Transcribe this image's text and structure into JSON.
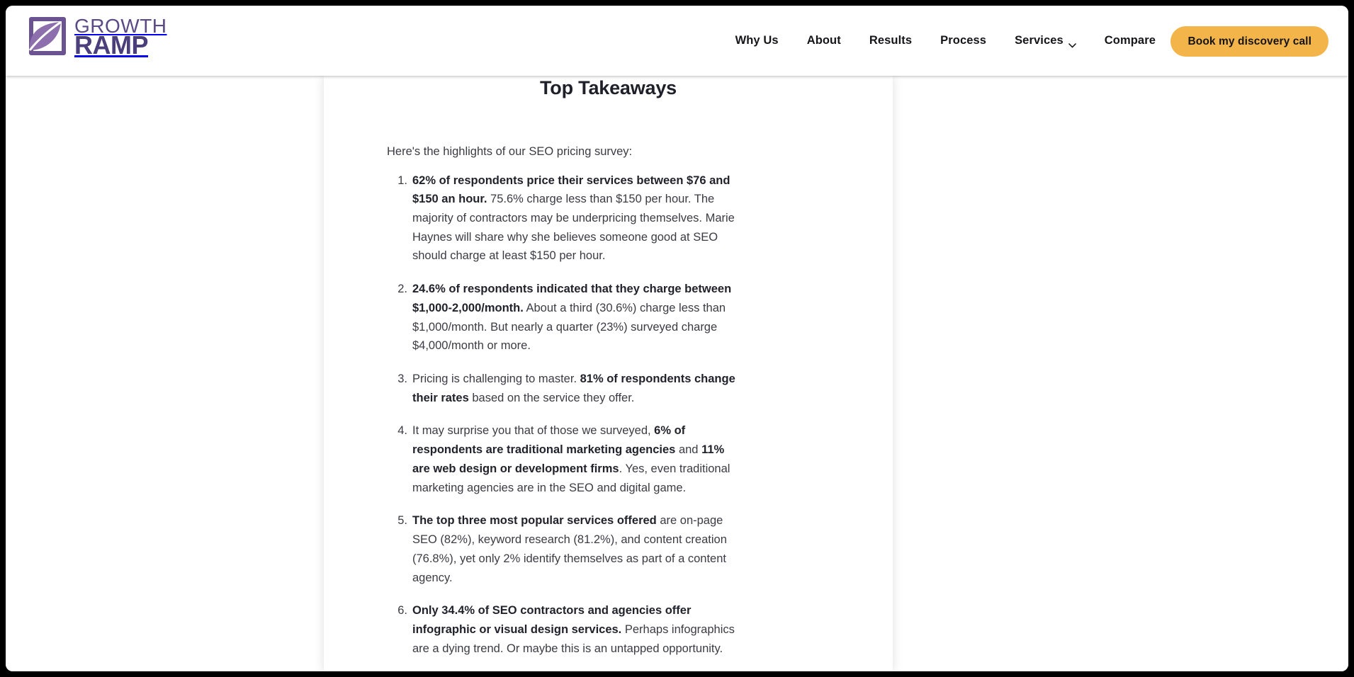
{
  "header": {
    "logo": {
      "top_word": "GROWTH",
      "bottom_word": "RAMP",
      "mark_icon": "leaf-mark-icon"
    },
    "nav": [
      {
        "label": "Why Us",
        "has_dropdown": false
      },
      {
        "label": "About",
        "has_dropdown": false
      },
      {
        "label": "Results",
        "has_dropdown": false
      },
      {
        "label": "Process",
        "has_dropdown": false
      },
      {
        "label": "Services",
        "has_dropdown": true,
        "dropdown_icon": "chevron-down-icon"
      },
      {
        "label": "Compare",
        "has_dropdown": false
      }
    ],
    "cta_label": "Book my discovery call",
    "cta_color": "#f3b54a"
  },
  "article": {
    "title": "Top Takeaways",
    "intro": "Here's the highlights of our SEO pricing survey:",
    "takeaways": [
      {
        "number": "1.",
        "runs": [
          {
            "bold": true,
            "text": "62% of respondents price their services between $76 and $150 an hour."
          },
          {
            "bold": false,
            "text": " 75.6% charge less than $150 per hour. The majority of contractors may be underpricing themselves. Marie Haynes will share why she believes someone good at SEO should charge at least $150 per hour."
          }
        ]
      },
      {
        "number": "2.",
        "runs": [
          {
            "bold": true,
            "text": "24.6% of respondents indicated that they charge between $1,000-2,000/month."
          },
          {
            "bold": false,
            "text": " About a third (30.6%) charge less than $1,000/month. But nearly a quarter (23%) surveyed charge $4,000/month or more."
          }
        ]
      },
      {
        "number": "3.",
        "runs": [
          {
            "bold": false,
            "text": "Pricing is challenging to master. "
          },
          {
            "bold": true,
            "text": "81% of respondents change their rates"
          },
          {
            "bold": false,
            "text": " based on the service they offer."
          }
        ]
      },
      {
        "number": "4.",
        "runs": [
          {
            "bold": false,
            "text": "It may surprise you that of those we surveyed, "
          },
          {
            "bold": true,
            "text": "6% of respondents are traditional marketing agencies"
          },
          {
            "bold": false,
            "text": " and "
          },
          {
            "bold": true,
            "text": "11% are web design or development firms"
          },
          {
            "bold": false,
            "text": ". Yes, even traditional marketing agencies are in the SEO and digital game."
          }
        ]
      },
      {
        "number": "5.",
        "runs": [
          {
            "bold": true,
            "text": "The top three most popular services offered"
          },
          {
            "bold": false,
            "text": " are on-page SEO (82%), keyword research (81.2%), and content creation (76.8%), yet only 2% identify themselves as part of a content agency."
          }
        ]
      },
      {
        "number": "6.",
        "runs": [
          {
            "bold": true,
            "text": "Only 34.4% of SEO contractors and agencies offer infographic or visual design services."
          },
          {
            "bold": false,
            "text": " Perhaps infographics are a dying trend. Or maybe this is an untapped opportunity."
          }
        ]
      }
    ]
  }
}
